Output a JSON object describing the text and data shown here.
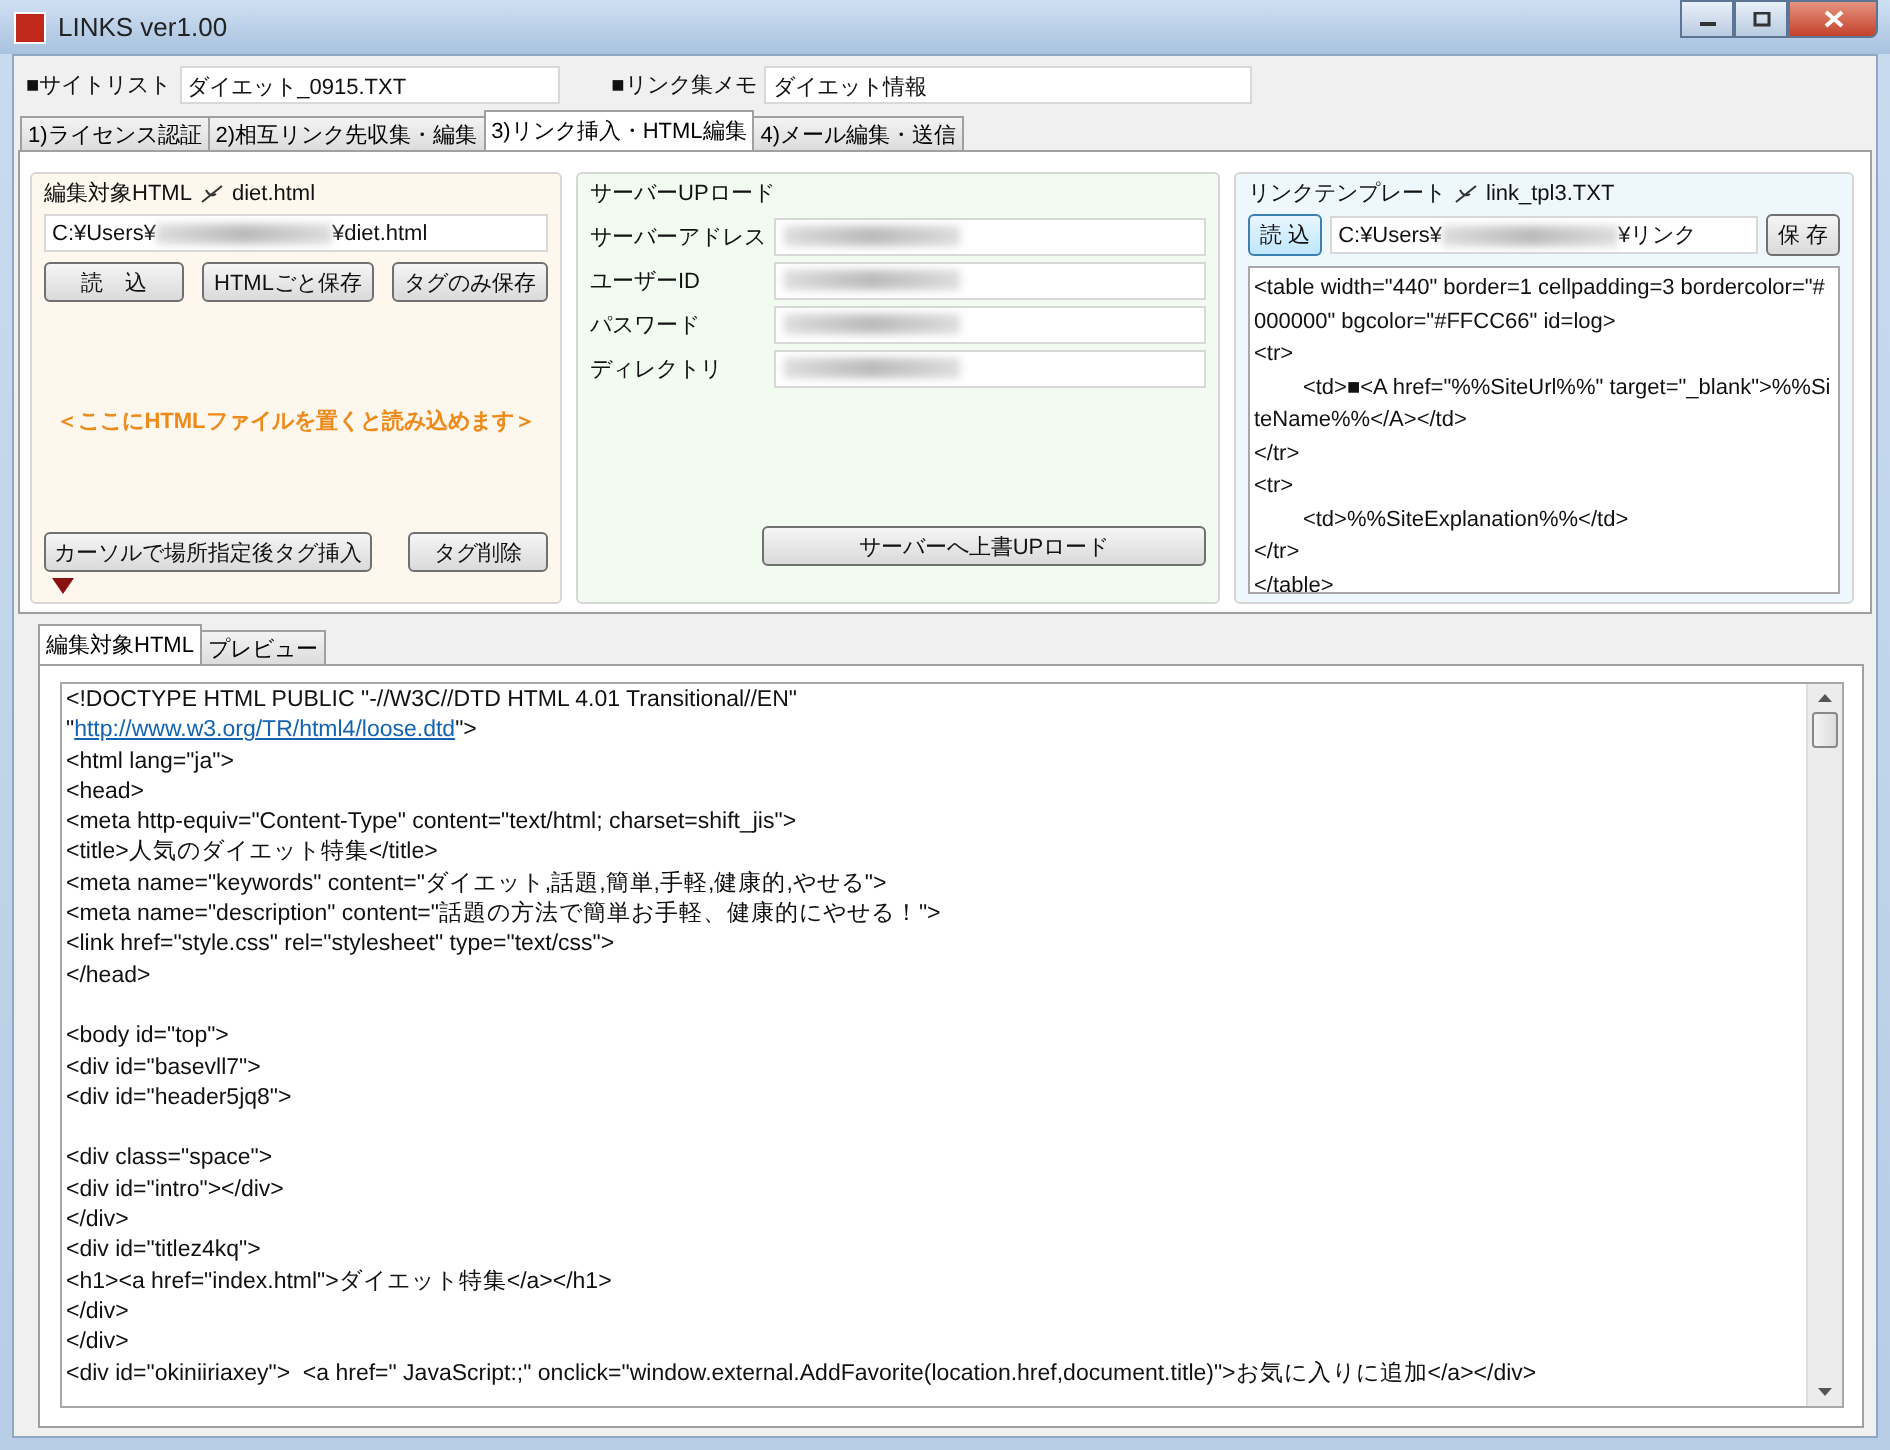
{
  "window": {
    "title": "LINKS ver1.00"
  },
  "header": {
    "site_list": {
      "label": "■サイトリスト",
      "value": "ダイエット_0915.TXT"
    },
    "link_memo": {
      "label": "■リンク集メモ",
      "value": "ダイエット情報"
    }
  },
  "tabs": [
    {
      "label": "1)ライセンス認証",
      "selected": false
    },
    {
      "label": "2)相互リンク先収集・編集",
      "selected": false
    },
    {
      "label": "3)リンク挿入・HTML編集",
      "selected": true
    },
    {
      "label": "4)メール編集・送信",
      "selected": false
    }
  ],
  "html_panel": {
    "title": "編集対象HTML",
    "file": "diet.html",
    "path_start": "C:¥Users¥",
    "path_end": "¥diet.html",
    "buttons": [
      "読　込",
      "HTMLごと保存",
      "タグのみ保存"
    ],
    "drop_hint": "＜ここにHTMLファイルを置くと読み込めます＞",
    "bottom_buttons": [
      "カーソルで場所指定後タグ挿入",
      "タグ削除"
    ]
  },
  "server_panel": {
    "title": "サーバーUPロード",
    "fields": [
      {
        "label": "サーバーアドレス"
      },
      {
        "label": "ユーザーID"
      },
      {
        "label": "パスワード"
      },
      {
        "label": "ディレクトリ"
      }
    ],
    "upload_button": "サーバーへ上書UPロード"
  },
  "template_panel": {
    "title": "リンクテンプレート",
    "file": "link_tpl3.TXT",
    "load_button": "読 込",
    "path_start": "C:¥Users¥",
    "path_end": "¥リンク",
    "save_button": "保 存",
    "lines": [
      "<table width=\"440\" border=1 cellpadding=3 bordercolor=\"#000000\" bgcolor=\"#FFCC66\" id=log>",
      "<tr>",
      "\t<td>■<A href=\"%%SiteUrl%%\" target=\"_blank\">%%SiteName%%</A></td>",
      "</tr>",
      "<tr>",
      "\t<td>%%SiteExplanation%%</td>",
      "</tr>",
      "</table>"
    ]
  },
  "editor_tabs": [
    {
      "label": "編集対象HTML",
      "selected": true
    },
    {
      "label": "プレビュー",
      "selected": false
    }
  ],
  "editor": {
    "blocks": [
      [
        {
          "text": "<!DOCTYPE HTML PUBLIC \"-//W3C//DTD HTML 4.01 Transitional//EN\""
        },
        {
          "text": "\"",
          "link": "http://www.w3.org/TR/html4/loose.dtd",
          "after": "\">"
        },
        {
          "text": "<html lang=\"ja\">"
        },
        {
          "text": "<head>"
        },
        {
          "text": "<meta http-equiv=\"Content-Type\" content=\"text/html; charset=shift_jis\">"
        },
        {
          "text": "<title>人気のダイエット特集</title>"
        },
        {
          "text": "<meta name=\"keywords\" content=\"ダイエット,話題,簡単,手軽,健康的,やせる\">"
        },
        {
          "text": "<meta name=\"description\" content=\"話題の方法で簡単お手軽、健康的にやせる！\">"
        },
        {
          "text": "<link href=\"style.css\" rel=\"stylesheet\" type=\"text/css\">"
        },
        {
          "text": "</head>"
        }
      ],
      [
        {
          "text": "<body id=\"top\">"
        },
        {
          "text": "<div id=\"basevll7\">"
        },
        {
          "text": "<div id=\"header5jq8\">"
        }
      ],
      [
        {
          "text": "<div class=\"space\">"
        },
        {
          "text": "<div id=\"intro\"></div>"
        },
        {
          "text": "</div>"
        },
        {
          "text": "<div id=\"titlez4kq\">"
        },
        {
          "text": "<h1><a href=\"index.html\">ダイエット特集</a></h1>"
        },
        {
          "text": "</div>"
        },
        {
          "text": "</div>"
        },
        {
          "text": "<div id=\"okiniiriaxey\">  <a href=\" JavaScript:;\" onclick=\"window.external.AddFavorite(location.href,document.title)\">お気に入りに追加</a></div>"
        }
      ]
    ]
  }
}
